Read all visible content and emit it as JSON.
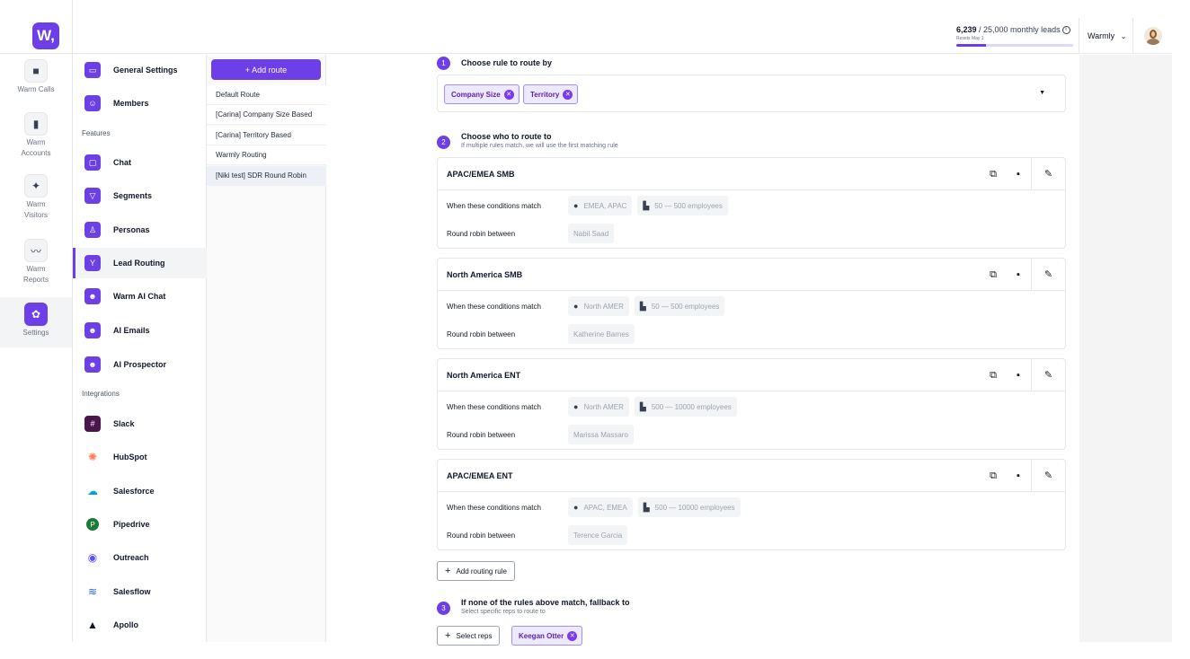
{
  "app": {
    "logo_text": "W,"
  },
  "header": {
    "leads_used": "6,239",
    "leads_total": " / 25,000 monthly leads",
    "resets": "Resets May 1",
    "leads_fraction": 0.25,
    "workspace": "Warmly"
  },
  "rail": [
    {
      "label": "Warm Calls",
      "icon": "video-icon"
    },
    {
      "label": "Warm Accounts",
      "icon": "bar-chart-icon"
    },
    {
      "label": "Warm Visitors",
      "icon": "walking-person-icon"
    },
    {
      "label": "Warm Reports",
      "icon": "trend-line-icon"
    },
    {
      "label": "Settings",
      "icon": "gear-icon"
    }
  ],
  "nav": {
    "top": [
      {
        "label": "General Settings"
      },
      {
        "label": "Members"
      }
    ],
    "features_heading": "Features",
    "features": [
      {
        "label": "Chat"
      },
      {
        "label": "Segments"
      },
      {
        "label": "Personas"
      },
      {
        "label": "Lead Routing"
      },
      {
        "label": "Warm AI Chat"
      },
      {
        "label": "AI Emails"
      },
      {
        "label": "AI Prospector"
      }
    ],
    "integrations_heading": "Integrations",
    "integrations": [
      {
        "label": "Slack",
        "color": "#4a154b"
      },
      {
        "label": "HubSpot",
        "color": "#ff7a59"
      },
      {
        "label": "Salesforce",
        "color": "#00a1e0"
      },
      {
        "label": "Pipedrive",
        "color": "#1f7a3a"
      },
      {
        "label": "Outreach",
        "color": "#5951ff"
      },
      {
        "label": "Salesflow",
        "color": "#2563eb"
      },
      {
        "label": "Apollo",
        "color": "#111827"
      }
    ]
  },
  "routes": {
    "add_label": "+  Add route",
    "items": [
      "Default Route",
      "[Carina] Company Size Based",
      "[Carina] Territory Based",
      "Warmly Routing",
      "[Niki test] SDR Round Robin"
    ]
  },
  "steps": {
    "s1": {
      "num": "1",
      "title": "Choose rule to route by"
    },
    "s2": {
      "num": "2",
      "title": "Choose who to route to",
      "sub": "If multiple rules match, we will use the first matching rule"
    },
    "s3": {
      "num": "3",
      "title": "If none of the rules above match, fallback to",
      "sub": "Select specific reps to route to"
    }
  },
  "rule_chips": [
    "Company Size",
    "Territory"
  ],
  "labels": {
    "conditions": "When these conditions match",
    "round_robin": "Round robin between",
    "add_rule": "Add routing rule",
    "select_reps": "Select reps"
  },
  "cards": [
    {
      "title": "APAC/EMEA SMB",
      "region": "EMEA, APAC",
      "size": "50 — 500 employees",
      "rep": "Nabil Saad"
    },
    {
      "title": "North America SMB",
      "region": "North AMER",
      "size": "50 — 500 employees",
      "rep": "Katherine Barnes"
    },
    {
      "title": "North America ENT",
      "region": "North AMER",
      "size": "500 — 10000 employees",
      "rep": "Marissa Massaro"
    },
    {
      "title": "APAC/EMEA ENT",
      "region": "APAC, EMEA",
      "size": "500 — 10000 employees",
      "rep": "Terence Garcia"
    }
  ],
  "fallback_rep": "Keegan Otter",
  "colors": {
    "brand": "#6d3fe6",
    "chip_bg": "#ede9fe"
  }
}
